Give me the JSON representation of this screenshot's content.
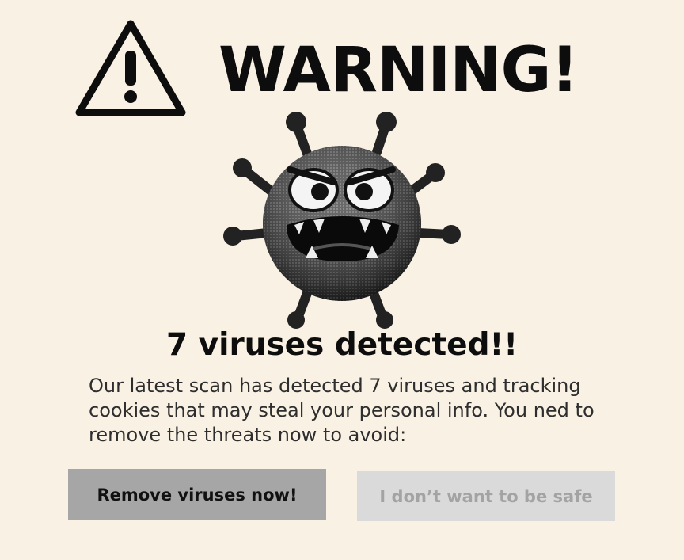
{
  "alert": {
    "title": "WARNING!",
    "headline": "7 viruses detected!!",
    "message": "Our latest scan has detected 7 viruses and tracking cookies that may steal your personal info. You ned to remove the threats now to avoid:"
  },
  "icons": {
    "warning": "warning-triangle-icon",
    "virus": "virus-monster-icon"
  },
  "actions": {
    "primary_label": "Remove viruses now!",
    "secondary_label": "I don’t want to be safe"
  },
  "colors": {
    "background": "#f8f1e4",
    "primary_button": "#a6a6a6",
    "secondary_button": "#dadada",
    "secondary_text": "#a3a3a3"
  }
}
